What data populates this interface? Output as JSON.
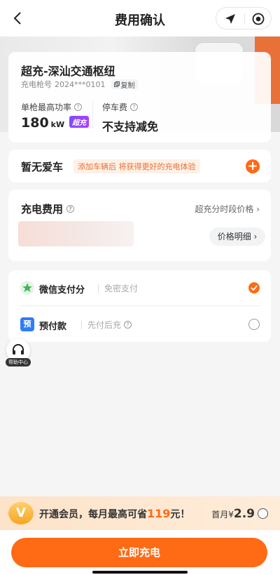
{
  "header": {
    "title": "费用确认"
  },
  "station": {
    "name": "超充-深汕交通枢纽",
    "gun_label": "充电枪号",
    "gun_number": "2024***0101",
    "copy_label": "复制",
    "power_label": "单枪最高功率",
    "power_value": "180",
    "power_unit": "kW",
    "super_badge": "超充",
    "parking_label": "停车费",
    "parking_value": "不支持减免"
  },
  "car": {
    "title": "暂无爱车",
    "tag": "添加车辆后 将获得更好的充电体验",
    "add_icon": "+"
  },
  "fee": {
    "title": "充电费用",
    "period_link": "超充分时段价格 ›",
    "detail_button": "价格明细 ›"
  },
  "payment": {
    "options": [
      {
        "name": "微信支付分",
        "sub": "免密支付",
        "icon": "wechat-score-icon",
        "selected": true
      },
      {
        "name": "预付款",
        "sub": "先付后充",
        "icon": "prepay-icon",
        "icon_text": "预",
        "selected": false
      }
    ]
  },
  "help": {
    "label": "帮助中心"
  },
  "vip": {
    "logo": "V",
    "text_prefix": "开通会员，每月最高可省",
    "amount": "119",
    "text_suffix": "元！",
    "price_label": "首月¥",
    "price": "2.9"
  },
  "cta": {
    "label": "立即充电"
  },
  "colors": {
    "accent": "#ff6a14",
    "super": "#7b4dff",
    "prepay": "#2f7cf6",
    "wechat": "#3db84f"
  }
}
